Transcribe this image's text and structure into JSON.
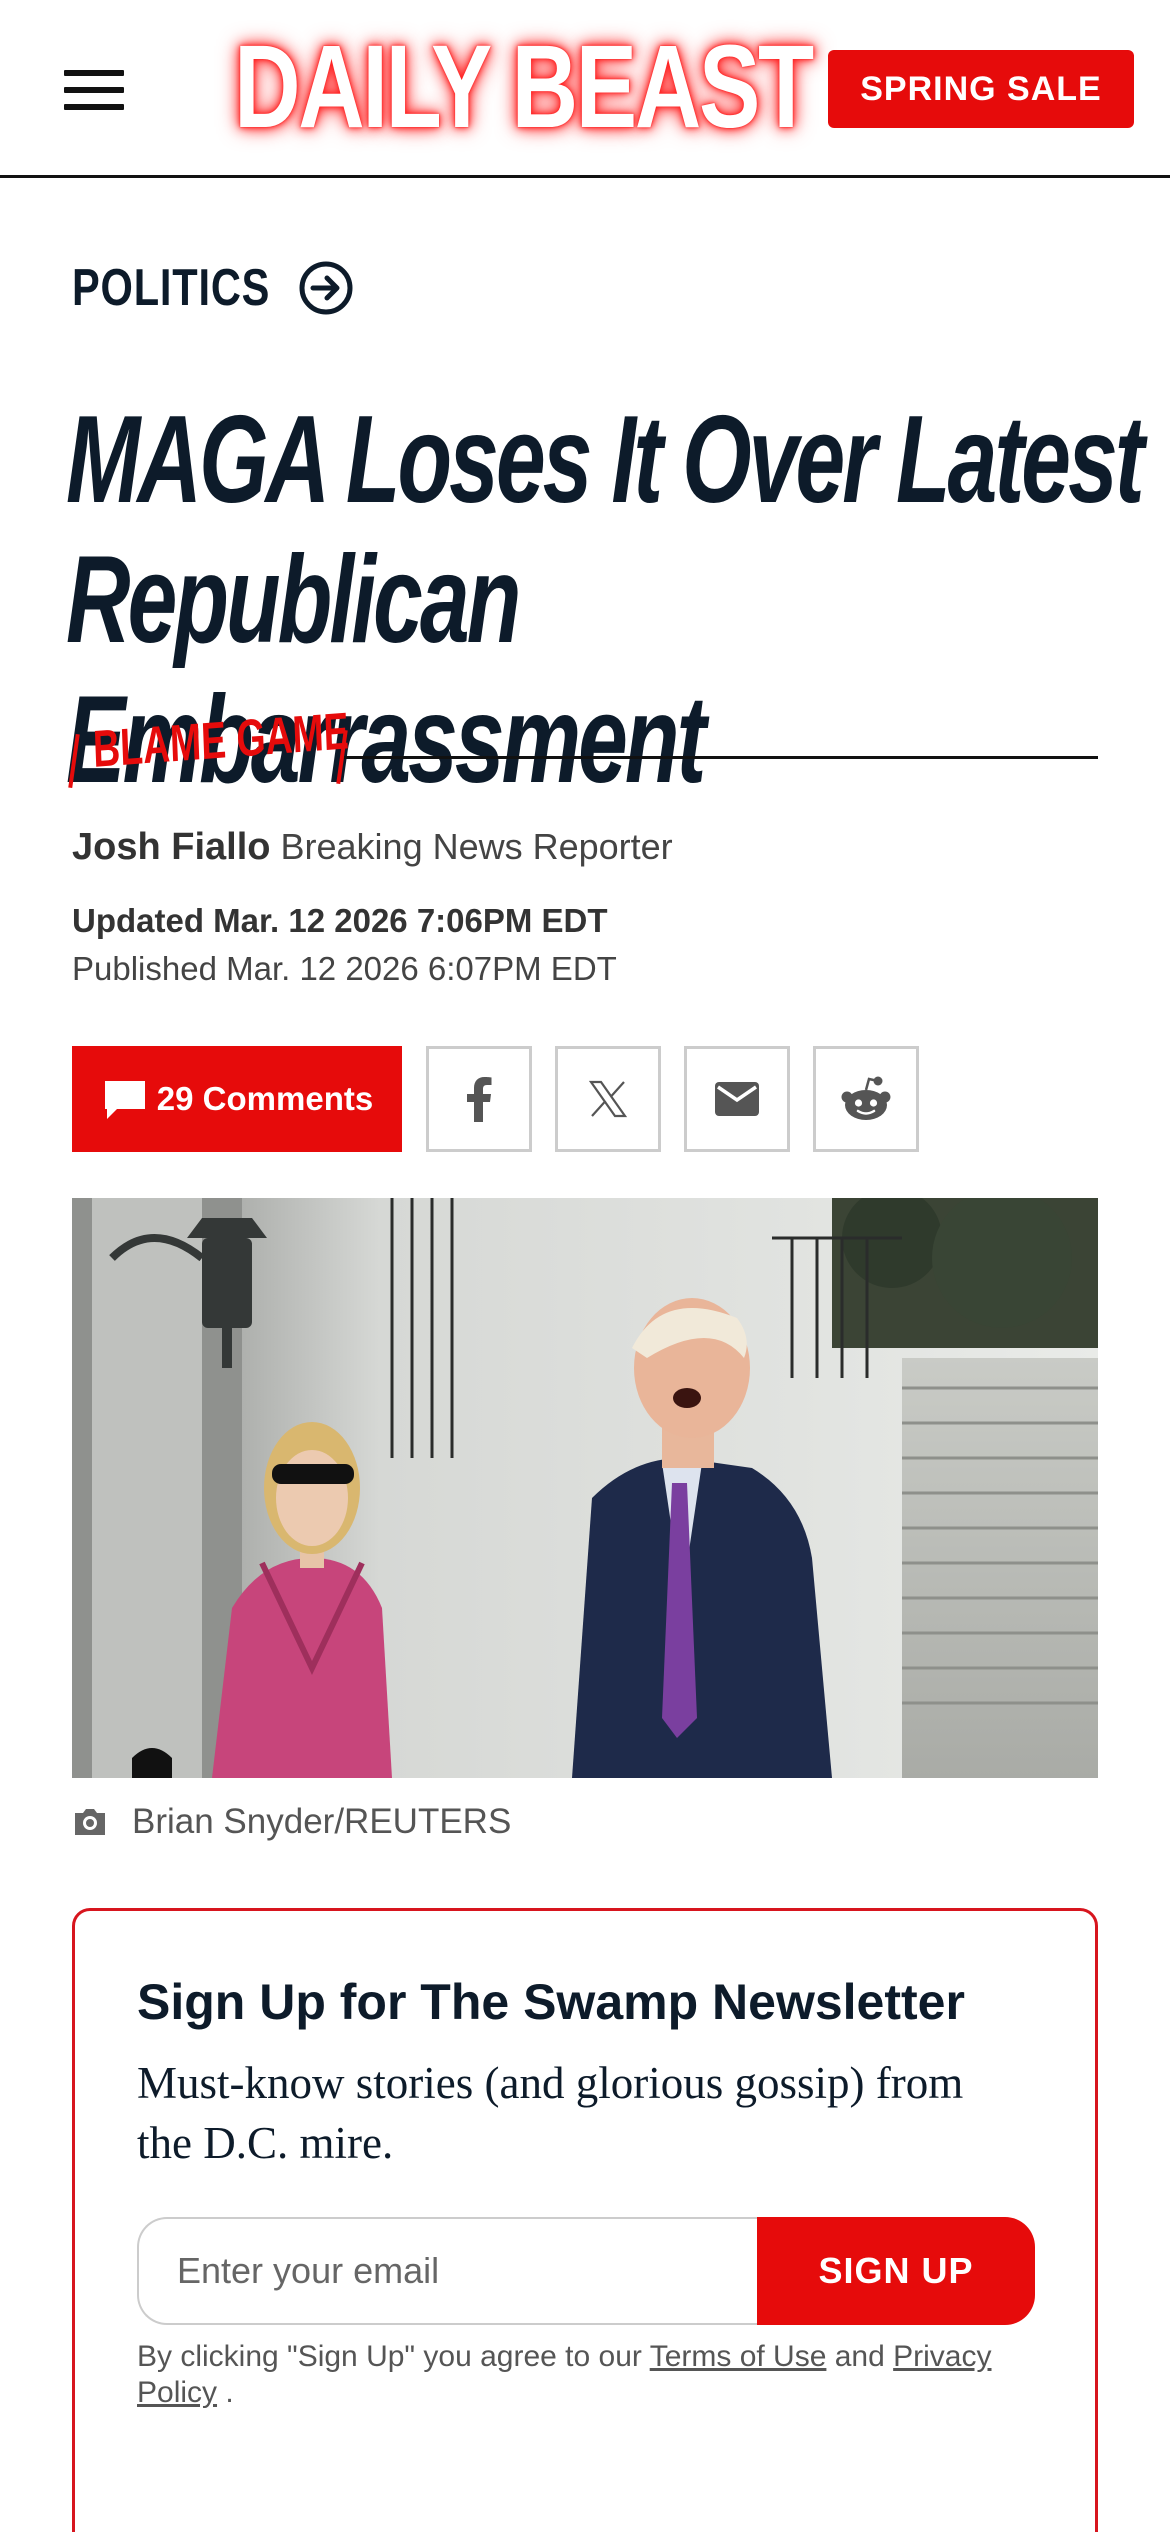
{
  "header": {
    "menu_icon": "hamburger-menu-icon",
    "logo": "DAILY BEAST",
    "sale_label": "SPRING SALE"
  },
  "article": {
    "section": "POLITICS",
    "section_icon": "circle-arrow-right-icon",
    "headline_line1": "MAGA Loses It Over Latest",
    "headline_line2": "Republican Embarrassment",
    "kicker": "BLAME GAME",
    "author": "Josh Fiallo",
    "author_role": "Breaking News Reporter",
    "updated": "Updated Mar. 12 2026 7:06PM EDT",
    "published": "Published Mar. 12 2026 6:07PM EDT"
  },
  "share": {
    "comments_label": "29 Comments",
    "comments_icon": "comment-bubble-icon",
    "facebook_icon": "facebook-icon",
    "x_icon": "x-icon",
    "email_icon": "email-icon",
    "reddit_icon": "reddit-icon"
  },
  "photo": {
    "camera_icon": "camera-icon",
    "credit": "Brian Snyder/REUTERS"
  },
  "newsletter": {
    "title": "Sign Up for The Swamp Newsletter",
    "description": "Must-know stories (and glorious gossip) from the D.C. mire.",
    "email_placeholder": "Enter your email",
    "submit_label": "SIGN UP",
    "legal_prefix": "By clicking \"Sign Up\" you agree to our ",
    "terms_label": "Terms of Use",
    "legal_and": " and ",
    "privacy_label": "Privacy Policy",
    "legal_suffix": " ."
  },
  "colors": {
    "brand_red": "#e60b0b",
    "headline_navy": "#0d1b2a",
    "border_red": "#d7151e"
  }
}
